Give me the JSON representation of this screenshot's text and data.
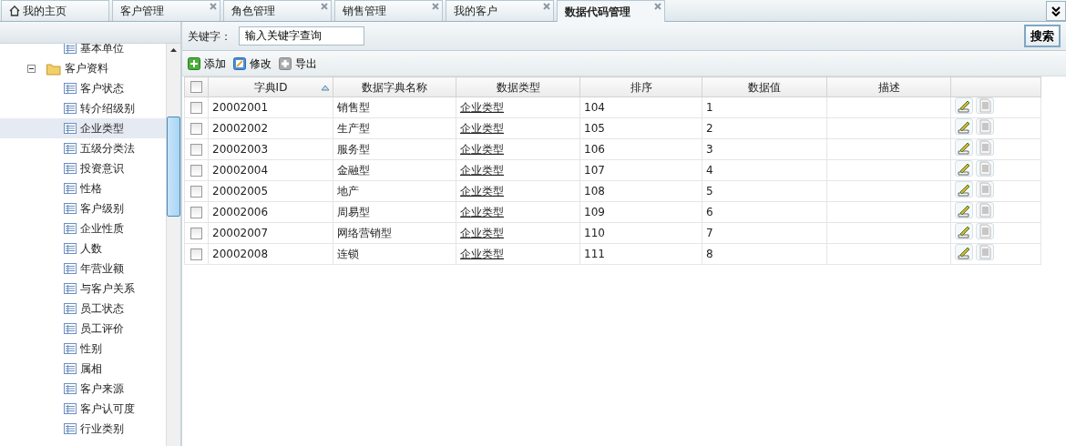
{
  "tabs": [
    {
      "label": "我的主页",
      "kind": "home",
      "selected": false
    },
    {
      "label": "客户管理",
      "kind": "closable",
      "selected": false
    },
    {
      "label": "角色管理",
      "kind": "closable",
      "selected": false
    },
    {
      "label": "销售管理",
      "kind": "closable",
      "selected": false
    },
    {
      "label": "我的客户",
      "kind": "closable",
      "selected": false
    },
    {
      "label": "数据代码管理",
      "kind": "closable",
      "selected": true
    }
  ],
  "tree": {
    "items": [
      {
        "label": "基本单位",
        "kind": "leaf",
        "selected": false
      },
      {
        "label": "客户资料",
        "kind": "folder",
        "expanded": true,
        "selected": false,
        "children": [
          {
            "label": "客户状态",
            "kind": "leaf",
            "selected": false
          },
          {
            "label": "转介绍级别",
            "kind": "leaf",
            "selected": false
          },
          {
            "label": "企业类型",
            "kind": "leaf",
            "selected": true
          },
          {
            "label": "五级分类法",
            "kind": "leaf",
            "selected": false
          },
          {
            "label": "投资意识",
            "kind": "leaf",
            "selected": false
          },
          {
            "label": "性格",
            "kind": "leaf",
            "selected": false
          },
          {
            "label": "客户级别",
            "kind": "leaf",
            "selected": false
          },
          {
            "label": "企业性质",
            "kind": "leaf",
            "selected": false
          },
          {
            "label": "人数",
            "kind": "leaf",
            "selected": false
          },
          {
            "label": "年营业额",
            "kind": "leaf",
            "selected": false
          },
          {
            "label": "与客户关系",
            "kind": "leaf",
            "selected": false
          },
          {
            "label": "员工状态",
            "kind": "leaf",
            "selected": false
          },
          {
            "label": "员工评价",
            "kind": "leaf",
            "selected": false
          },
          {
            "label": "性别",
            "kind": "leaf",
            "selected": false
          },
          {
            "label": "属相",
            "kind": "leaf",
            "selected": false
          },
          {
            "label": "客户来源",
            "kind": "leaf",
            "selected": false
          },
          {
            "label": "客户认可度",
            "kind": "leaf",
            "selected": false
          },
          {
            "label": "行业类别",
            "kind": "leaf",
            "selected": false
          }
        ]
      }
    ]
  },
  "search": {
    "label": "关键字：",
    "value": "输入关键字查询",
    "button": "搜索"
  },
  "toolbar": [
    {
      "label": "添加",
      "kind": "add"
    },
    {
      "label": "修改",
      "kind": "edit"
    },
    {
      "label": "导出",
      "kind": "export"
    }
  ],
  "table": {
    "all_checked": false,
    "columns": [
      "字典ID",
      "数据字典名称",
      "数据类型",
      "排序",
      "数据值",
      "描述"
    ],
    "rows": [
      {
        "checked": false,
        "cells": [
          "20002001",
          "销售型",
          "企业类型",
          "104",
          "1"
        ]
      },
      {
        "checked": false,
        "cells": [
          "20002002",
          "生产型",
          "企业类型",
          "105",
          "2"
        ]
      },
      {
        "checked": false,
        "cells": [
          "20002003",
          "服务型",
          "企业类型",
          "106",
          "3"
        ]
      },
      {
        "checked": false,
        "cells": [
          "20002004",
          "金融型",
          "企业类型",
          "107",
          "4"
        ]
      },
      {
        "checked": false,
        "cells": [
          "20002005",
          "地产",
          "企业类型",
          "108",
          "5"
        ]
      },
      {
        "checked": false,
        "cells": [
          "20002006",
          "周易型",
          "企业类型",
          "109",
          "6"
        ]
      },
      {
        "checked": false,
        "cells": [
          "20002007",
          "网络营销型",
          "企业类型",
          "110",
          "7"
        ]
      },
      {
        "checked": false,
        "cells": [
          "20002008",
          "连锁",
          "企业类型",
          "111",
          "8"
        ]
      }
    ]
  }
}
